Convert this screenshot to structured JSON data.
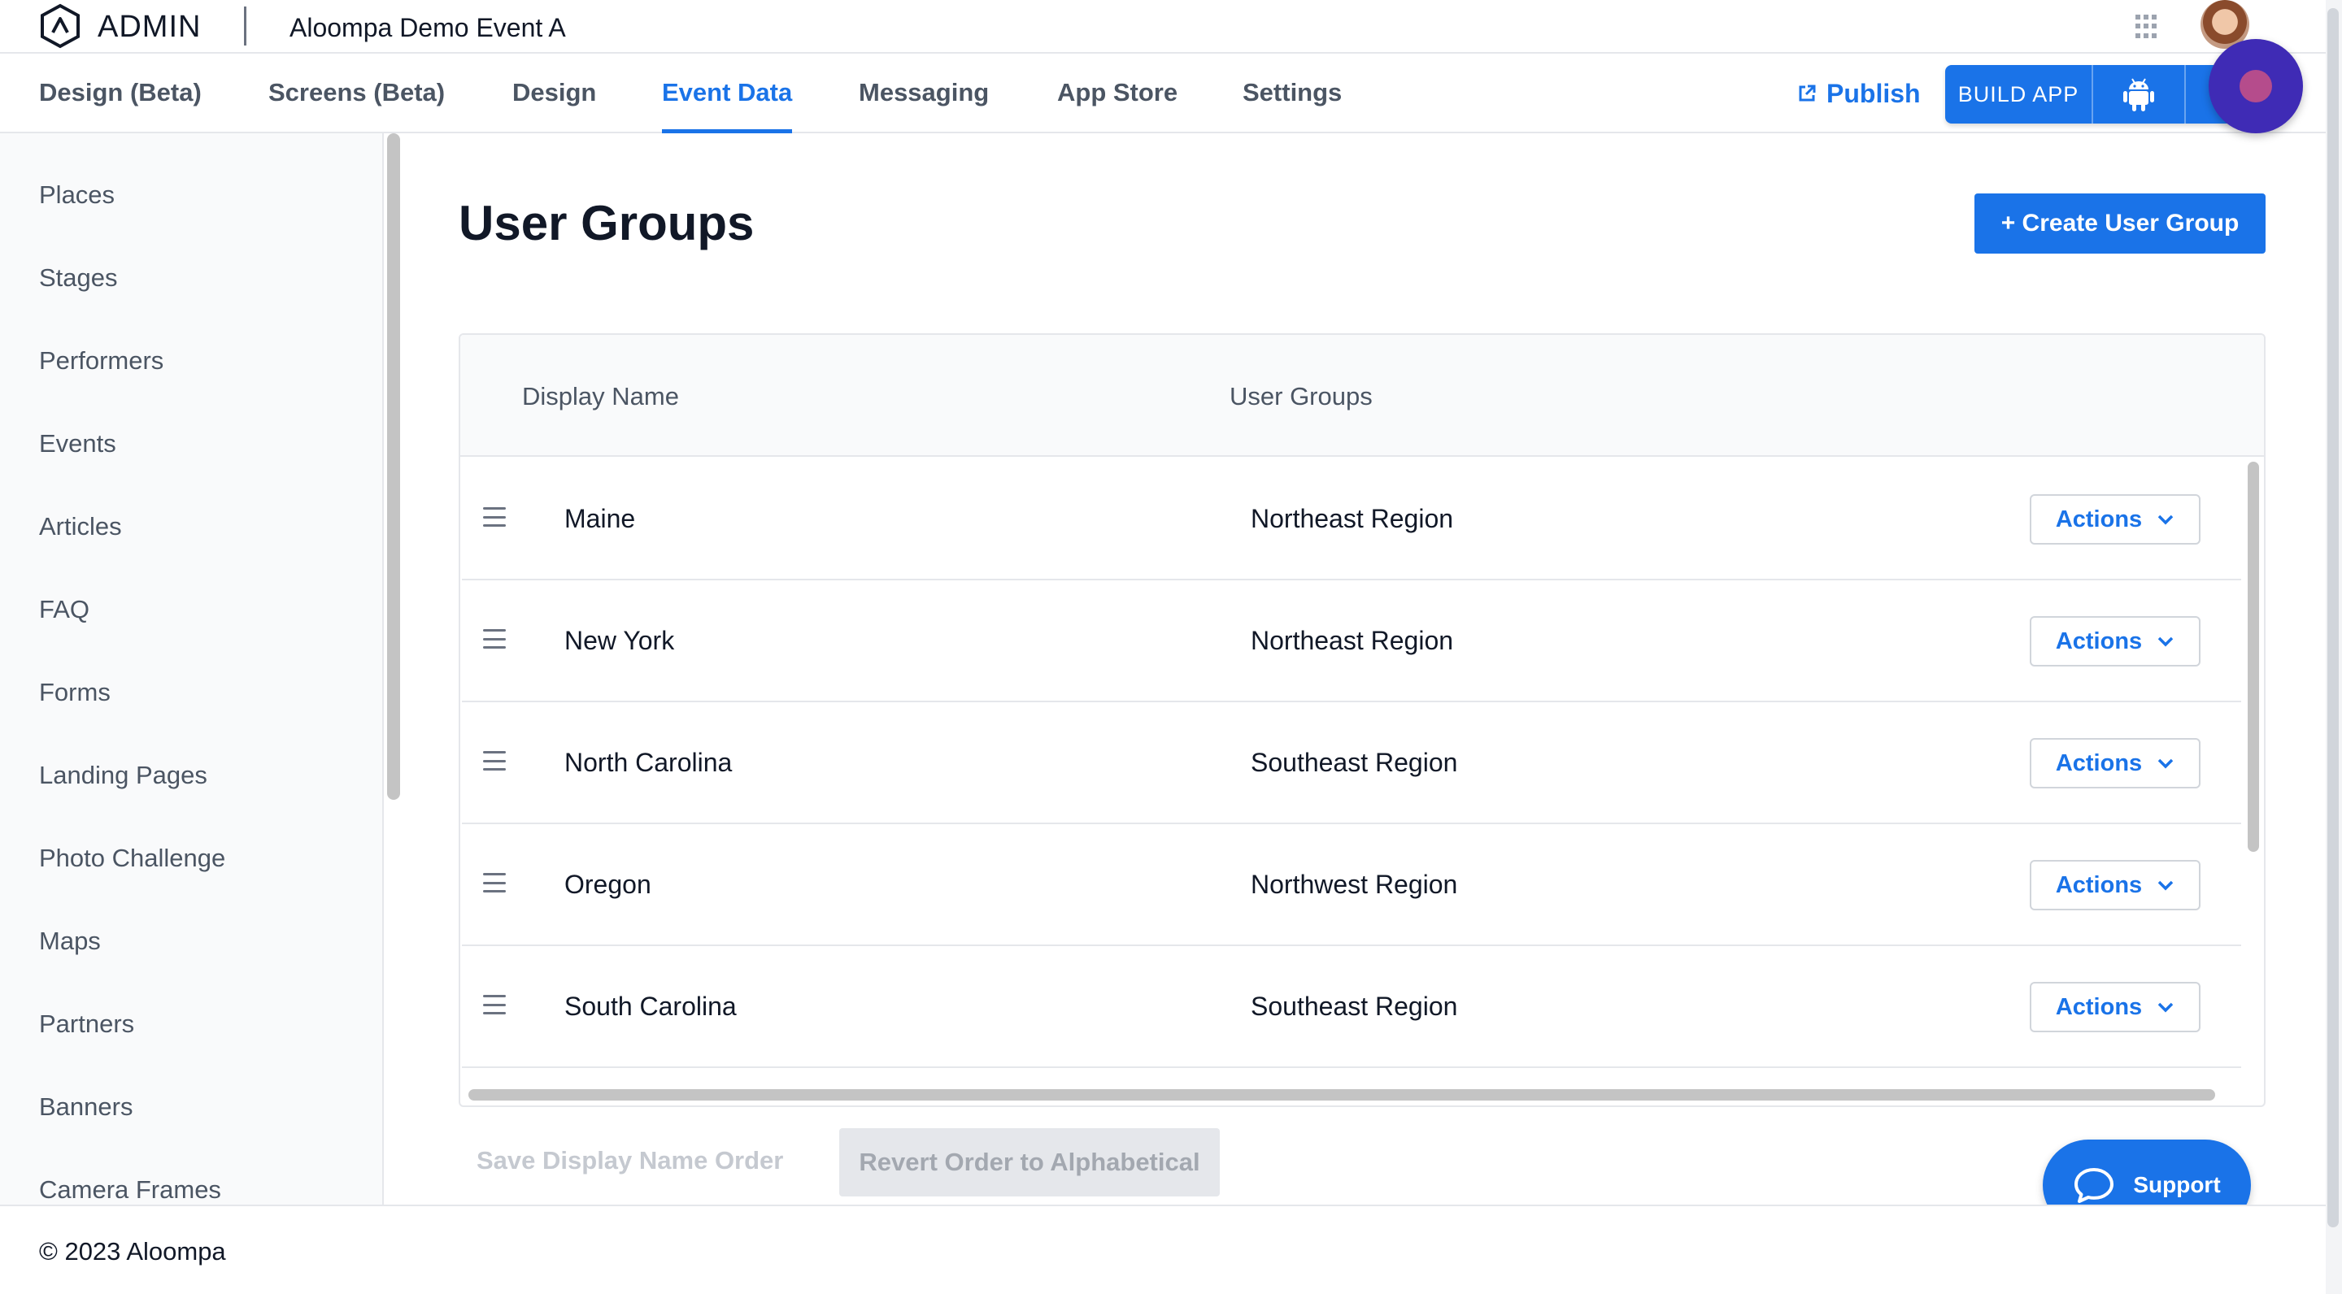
{
  "header": {
    "brand": "ADMIN",
    "event_name": "Aloompa Demo Event A"
  },
  "nav": {
    "tabs": [
      {
        "label": "Design (Beta)"
      },
      {
        "label": "Screens (Beta)"
      },
      {
        "label": "Design"
      },
      {
        "label": "Event Data",
        "active": true
      },
      {
        "label": "Messaging"
      },
      {
        "label": "App Store"
      },
      {
        "label": "Settings"
      }
    ],
    "publish_label": "Publish",
    "build_label": "BUILD APP"
  },
  "sidebar": {
    "items": [
      {
        "label": "Places"
      },
      {
        "label": "Stages"
      },
      {
        "label": "Performers"
      },
      {
        "label": "Events"
      },
      {
        "label": "Articles"
      },
      {
        "label": "FAQ"
      },
      {
        "label": "Forms"
      },
      {
        "label": "Landing Pages"
      },
      {
        "label": "Photo Challenge"
      },
      {
        "label": "Maps"
      },
      {
        "label": "Partners"
      },
      {
        "label": "Banners"
      },
      {
        "label": "Camera Frames"
      }
    ]
  },
  "main": {
    "title": "User Groups",
    "create_label": "+ Create User Group",
    "table": {
      "columns": [
        "Display Name",
        "User Groups"
      ],
      "rows": [
        {
          "name": "Maine",
          "group": "Northeast Region",
          "action": "Actions"
        },
        {
          "name": "New York",
          "group": "Northeast Region",
          "action": "Actions"
        },
        {
          "name": "North Carolina",
          "group": "Southeast Region",
          "action": "Actions"
        },
        {
          "name": "Oregon",
          "group": "Northwest Region",
          "action": "Actions"
        },
        {
          "name": "South Carolina",
          "group": "Southeast Region",
          "action": "Actions"
        }
      ]
    },
    "save_order_label": "Save Display Name Order",
    "revert_label": "Revert Order to Alphabetical"
  },
  "support": {
    "label": "Support"
  },
  "footer": {
    "copyright": "© 2023 Aloompa"
  },
  "colors": {
    "accent": "#1a73e8",
    "record": "#3f2bb5"
  }
}
